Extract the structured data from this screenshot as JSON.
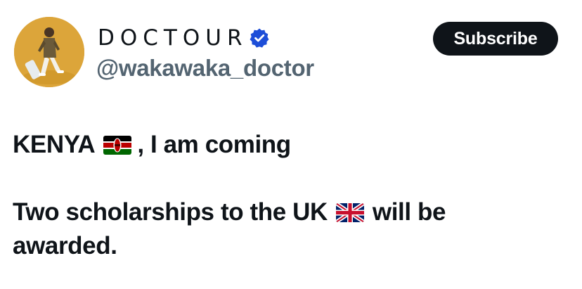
{
  "profile": {
    "display_name": "DOCTOUR",
    "handle": "@wakawaka_doctor",
    "verified": true,
    "avatar": "avatar-photo"
  },
  "actions": {
    "subscribe_label": "Subscribe"
  },
  "post": {
    "line1_part1": "KENYA",
    "line1_flag": "kenya-flag-icon",
    "line1_part2": ", I am coming",
    "line2_part1": "Two scholarships to the UK",
    "line2_flag": "uk-flag-icon",
    "line2_part2": "will be",
    "line3": "awarded."
  },
  "colors": {
    "text_primary": "#0f1419",
    "text_secondary": "#536471",
    "verified_badge": "#1d4ed8",
    "button_bg": "#0f1419",
    "button_text": "#ffffff"
  }
}
